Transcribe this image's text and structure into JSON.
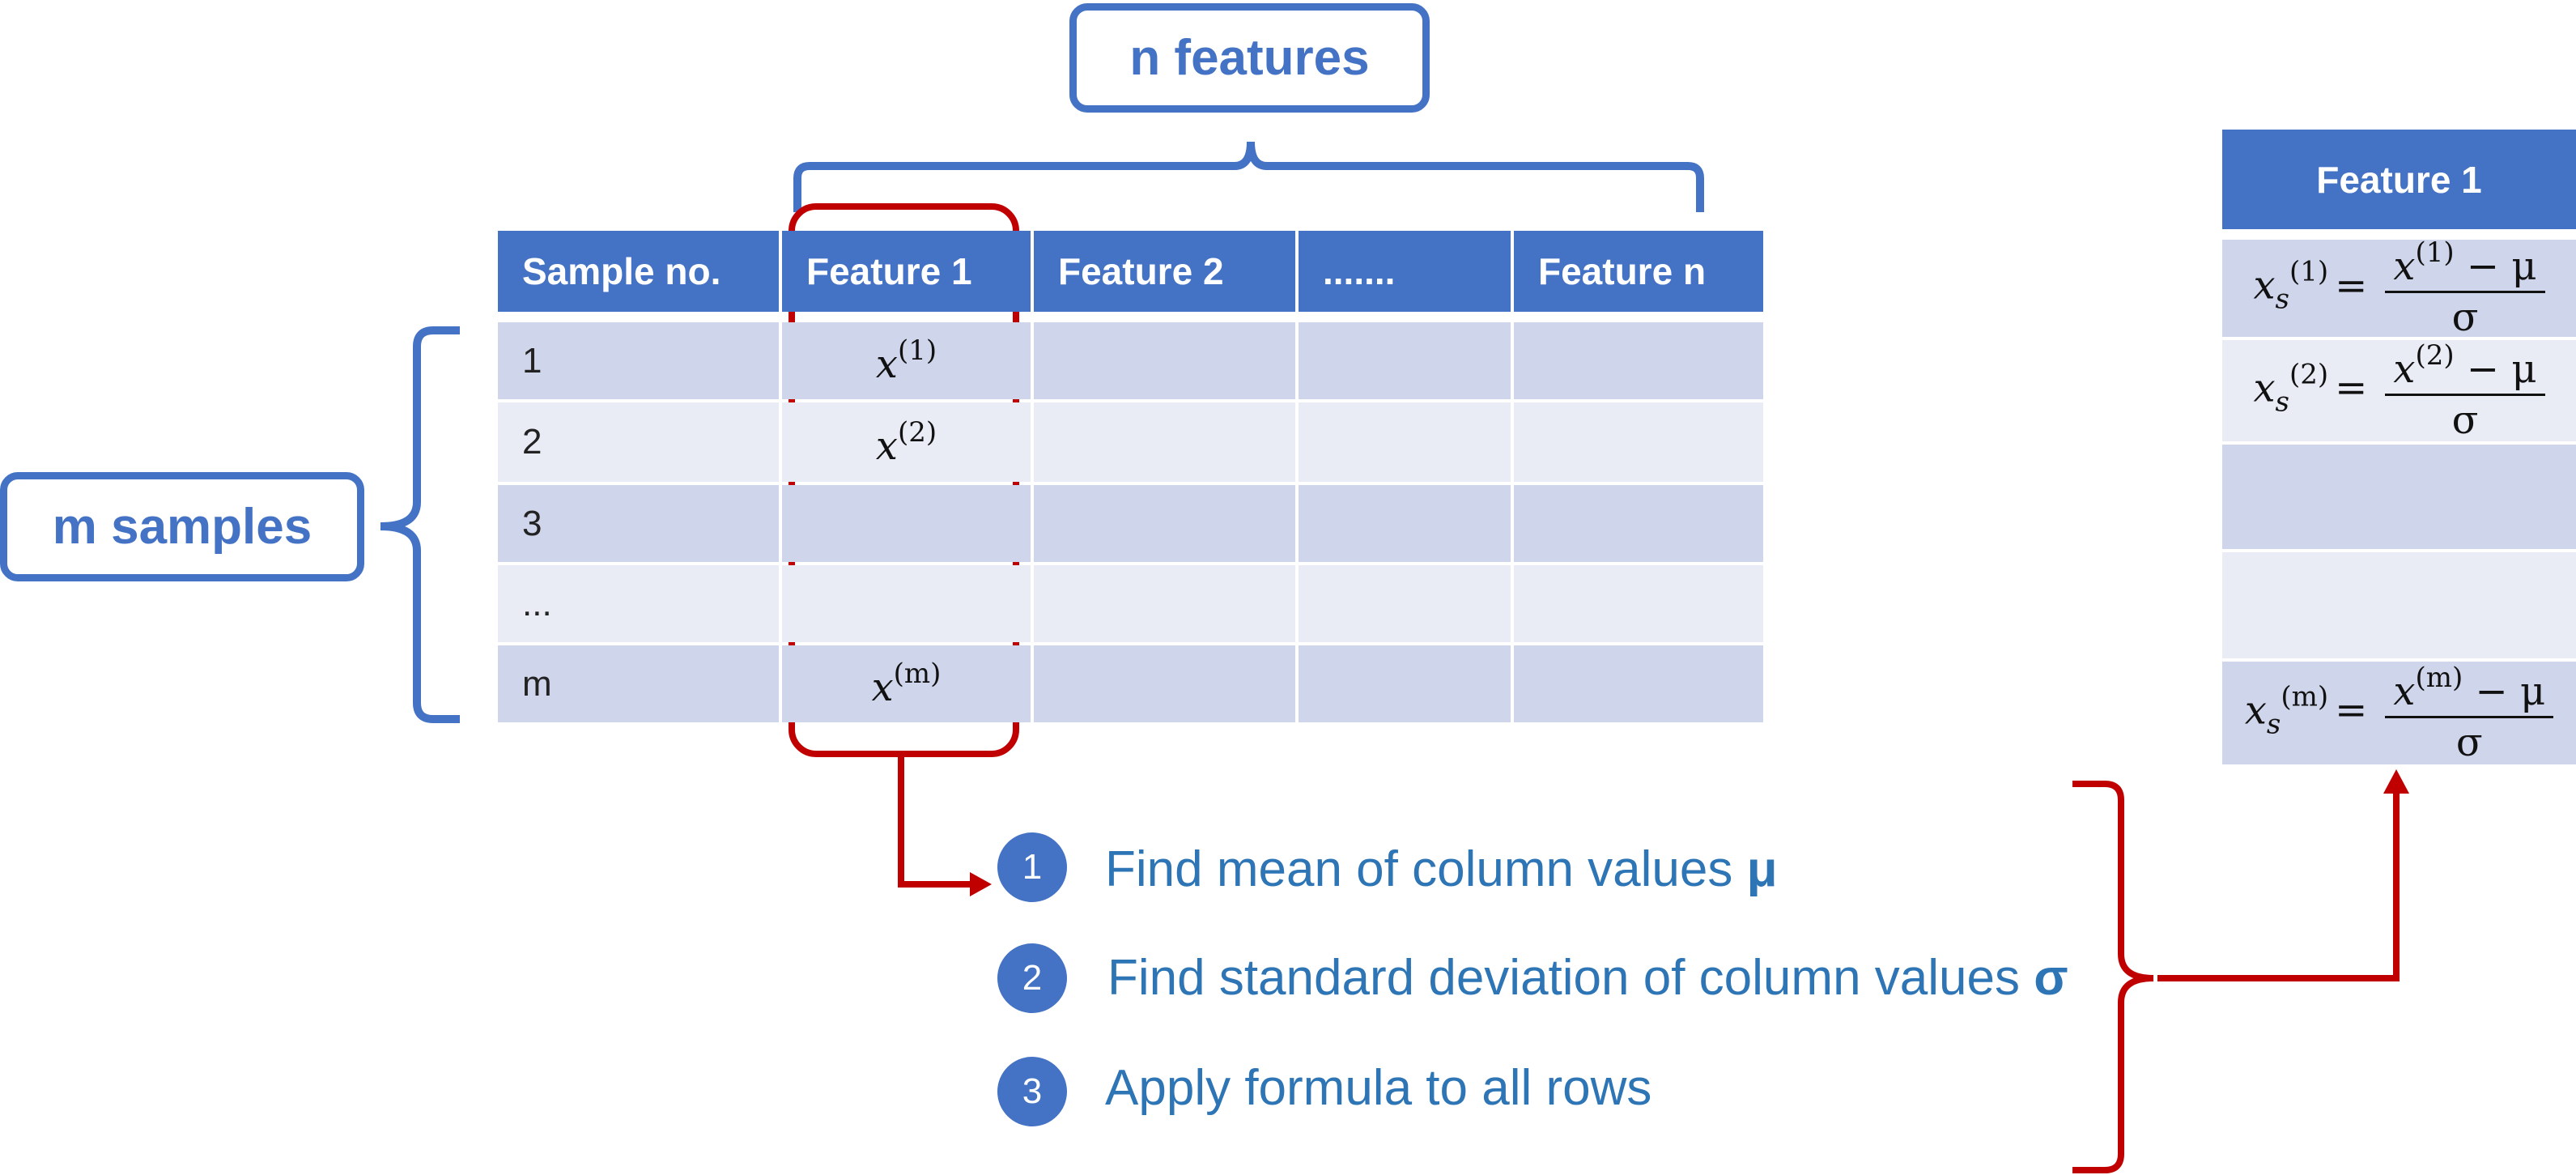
{
  "labels": {
    "n_features": "n features",
    "m_samples": "m samples"
  },
  "table": {
    "headers": [
      "Sample no.",
      "Feature 1",
      "Feature 2",
      ".......",
      "Feature n"
    ],
    "rows": [
      "1",
      "2",
      "3",
      "...",
      "m"
    ],
    "feature1_values": [
      "(1)",
      "(2)",
      "",
      "",
      "(m)"
    ],
    "variable": "x"
  },
  "right_panel": {
    "header": "Feature 1",
    "subscript": "s",
    "mu": "μ",
    "sigma": "σ",
    "minus": "−",
    "equals": "=",
    "superscripts": [
      "(1)",
      "(2)",
      "",
      "",
      "(m)"
    ]
  },
  "steps": [
    {
      "number": "1",
      "text": "Find mean of column values ",
      "symbol": "μ"
    },
    {
      "number": "2",
      "text": "Find standard deviation of column values ",
      "symbol": "σ"
    },
    {
      "number": "3",
      "text": "Apply formula to all rows",
      "symbol": ""
    }
  ],
  "colors": {
    "blue": "#4472c4",
    "red": "#c00000",
    "text_blue": "#2e75b6",
    "row_dark": "#cfd5ea",
    "row_light": "#e9ebf5"
  }
}
